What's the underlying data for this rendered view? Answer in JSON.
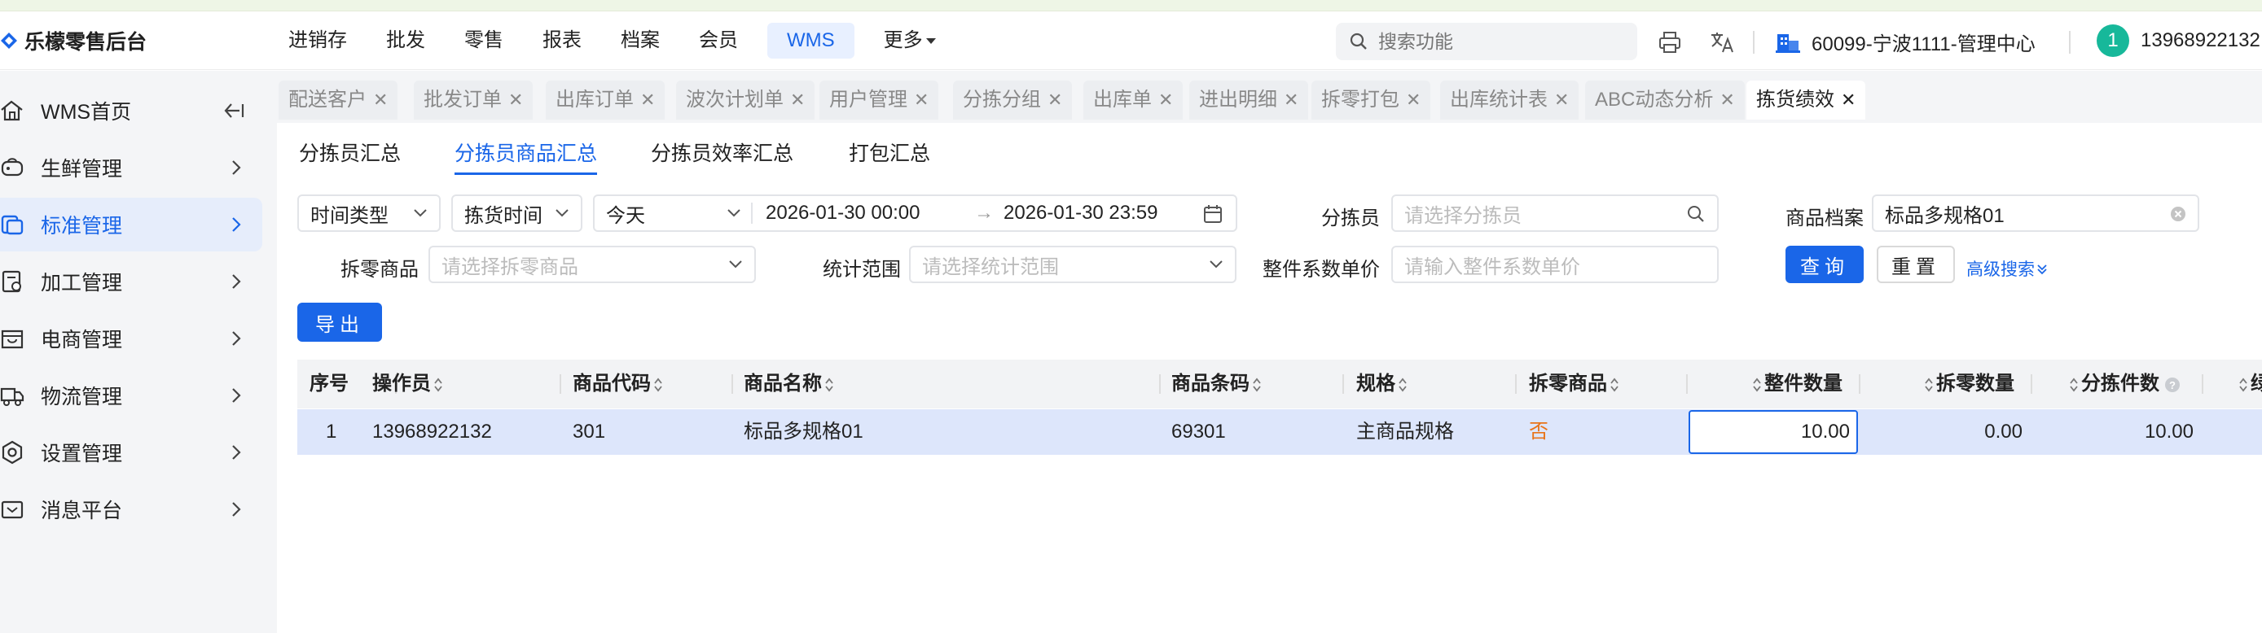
{
  "app": {
    "title": "乐檬零售后台",
    "brand_color": "#1a66e8"
  },
  "header": {
    "nav": [
      {
        "label": "进销存"
      },
      {
        "label": "批发"
      },
      {
        "label": "零售"
      },
      {
        "label": "报表"
      },
      {
        "label": "档案"
      },
      {
        "label": "会员"
      },
      {
        "label": "WMS",
        "active": true
      },
      {
        "label": "更多"
      }
    ],
    "search_placeholder": "搜索功能",
    "org": "60099-宁波1111-管理中心",
    "user_avatar": "1",
    "user_name": "13968922132"
  },
  "sidebar": {
    "items": [
      {
        "label": "WMS首页",
        "icon": "home-icon"
      },
      {
        "label": "生鲜管理",
        "icon": "fresh-icon"
      },
      {
        "label": "标准管理",
        "icon": "standard-icon",
        "active": true
      },
      {
        "label": "加工管理",
        "icon": "process-icon"
      },
      {
        "label": "电商管理",
        "icon": "ecommerce-icon"
      },
      {
        "label": "物流管理",
        "icon": "truck-icon"
      },
      {
        "label": "设置管理",
        "icon": "settings-icon"
      },
      {
        "label": "消息平台",
        "icon": "message-icon"
      }
    ]
  },
  "tabs": [
    {
      "label": "配送客户"
    },
    {
      "label": "批发订单"
    },
    {
      "label": "出库订单"
    },
    {
      "label": "波次计划单"
    },
    {
      "label": "用户管理"
    },
    {
      "label": "分拣分组"
    },
    {
      "label": "出库单"
    },
    {
      "label": "进出明细"
    },
    {
      "label": "拆零打包"
    },
    {
      "label": "出库统计表"
    },
    {
      "label": "ABC动态分析"
    },
    {
      "label": "拣货绩效",
      "active": true
    }
  ],
  "subtabs": [
    {
      "label": "分拣员汇总"
    },
    {
      "label": "分拣员商品汇总",
      "active": true
    },
    {
      "label": "分拣员效率汇总"
    },
    {
      "label": "打包汇总"
    }
  ],
  "filters": {
    "time_type": "时间类型",
    "time_field": "拣货时间",
    "range_preset": "今天",
    "date_start": "2026-01-30 00:00",
    "date_arrow": "→",
    "date_end": "2026-01-30 23:59",
    "picker_label": "分拣员",
    "picker_placeholder": "请选择分拣员",
    "product_label": "商品档案",
    "product_value": "标品多规格01",
    "split_label": "拆零商品",
    "split_placeholder": "请选择拆零商品",
    "scope_label": "统计范围",
    "scope_placeholder": "请选择统计范围",
    "unit_price_label": "整件系数单价",
    "unit_price_placeholder": "请输入整件系数单价",
    "query_button": "查询",
    "reset_button": "重置",
    "advanced": "高级搜索",
    "export_button": "导出"
  },
  "table": {
    "columns": [
      "序号",
      "操作员",
      "商品代码",
      "商品名称",
      "商品条码",
      "规格",
      "拆零商品",
      "整件数量",
      "拆零数量",
      "分拣件数",
      "绿"
    ],
    "rows": [
      {
        "index": "1",
        "operator": "13968922132",
        "code": "301",
        "name": "标品多规格01",
        "barcode": "69301",
        "spec": "主商品规格",
        "split": "否",
        "whole_qty": "10.00",
        "split_qty": "0.00",
        "pick_count": "10.00"
      }
    ]
  }
}
